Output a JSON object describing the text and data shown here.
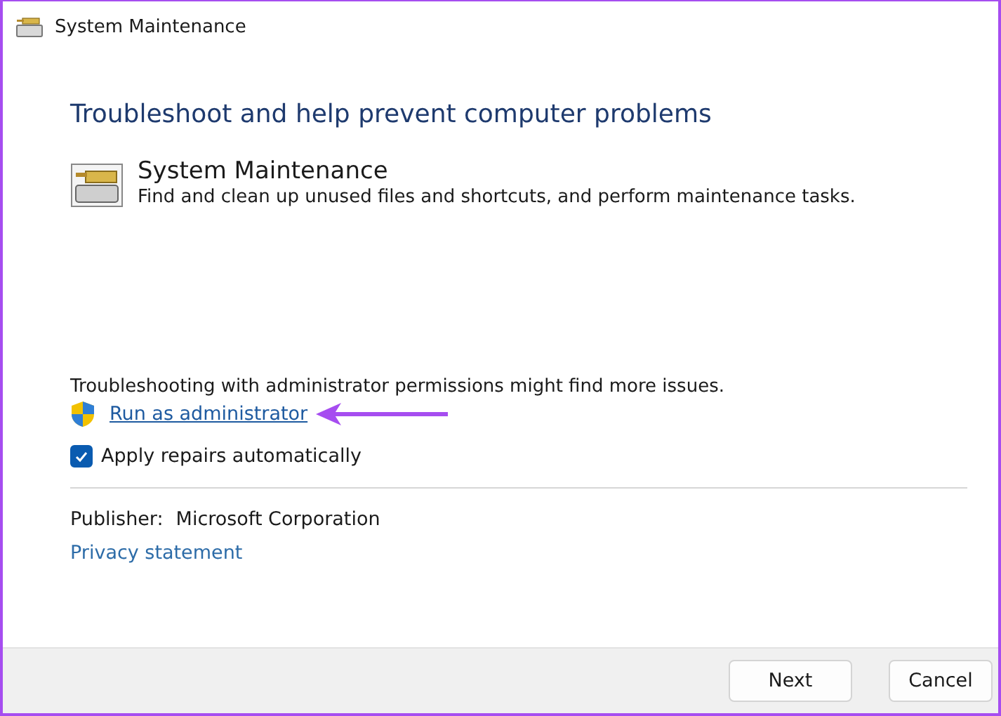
{
  "window": {
    "title": "System Maintenance"
  },
  "heading": "Troubleshoot and help prevent computer problems",
  "task": {
    "title": "System Maintenance",
    "description": "Find and clean up unused files and shortcuts, and perform maintenance tasks."
  },
  "admin_note": "Troubleshooting with administrator permissions might find more issues.",
  "admin_link": "Run as administrator",
  "auto_repair": {
    "label": "Apply repairs automatically",
    "checked": true
  },
  "publisher": {
    "label": "Publisher:",
    "value": "Microsoft Corporation"
  },
  "privacy_link": "Privacy statement",
  "buttons": [
    {
      "label": "Next"
    },
    {
      "label": "Cancel"
    }
  ]
}
